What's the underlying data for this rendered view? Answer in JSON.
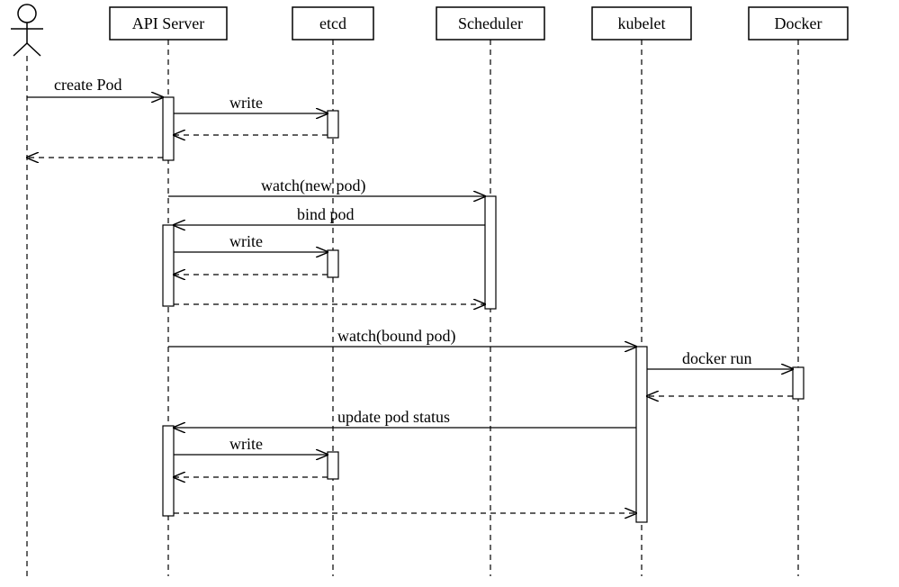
{
  "participants": {
    "actor": "User",
    "p1": "API Server",
    "p2": "etcd",
    "p3": "Scheduler",
    "p4": "kubelet",
    "p5": "Docker"
  },
  "messages": {
    "m1": "create Pod",
    "m2": "write",
    "m3": "watch(new pod)",
    "m4": "bind pod",
    "m5": "write",
    "m6": "watch(bound pod)",
    "m7": "docker run",
    "m8": "update pod status",
    "m9": "write"
  }
}
